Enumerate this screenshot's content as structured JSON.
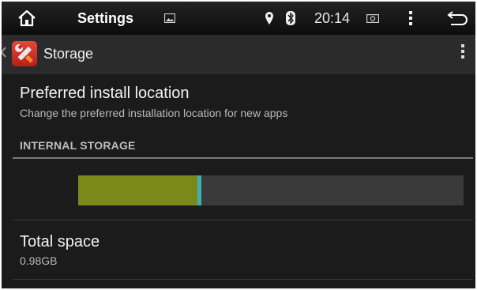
{
  "status_bar": {
    "title": "Settings",
    "time": "20:14",
    "icons": [
      "home-icon",
      "image-icon",
      "location-icon",
      "bluetooth-icon",
      "screenshot-icon",
      "menu-icon",
      "back-icon"
    ]
  },
  "action_bar": {
    "title": "Storage",
    "icons": [
      "storage-settings-icon",
      "overflow-menu-icon"
    ]
  },
  "preferred_install": {
    "title": "Preferred install location",
    "subtitle": "Change the preferred installation location for new apps"
  },
  "internal_storage": {
    "header": "INTERNAL STORAGE",
    "used_fraction": 0.31,
    "cache_fraction": 0.01,
    "colors": {
      "used": "#7a8a1a",
      "cache": "#3eb0b5",
      "free": "#3a3a3a"
    },
    "total_space_label": "Total space",
    "total_space_value": "0.98GB"
  }
}
